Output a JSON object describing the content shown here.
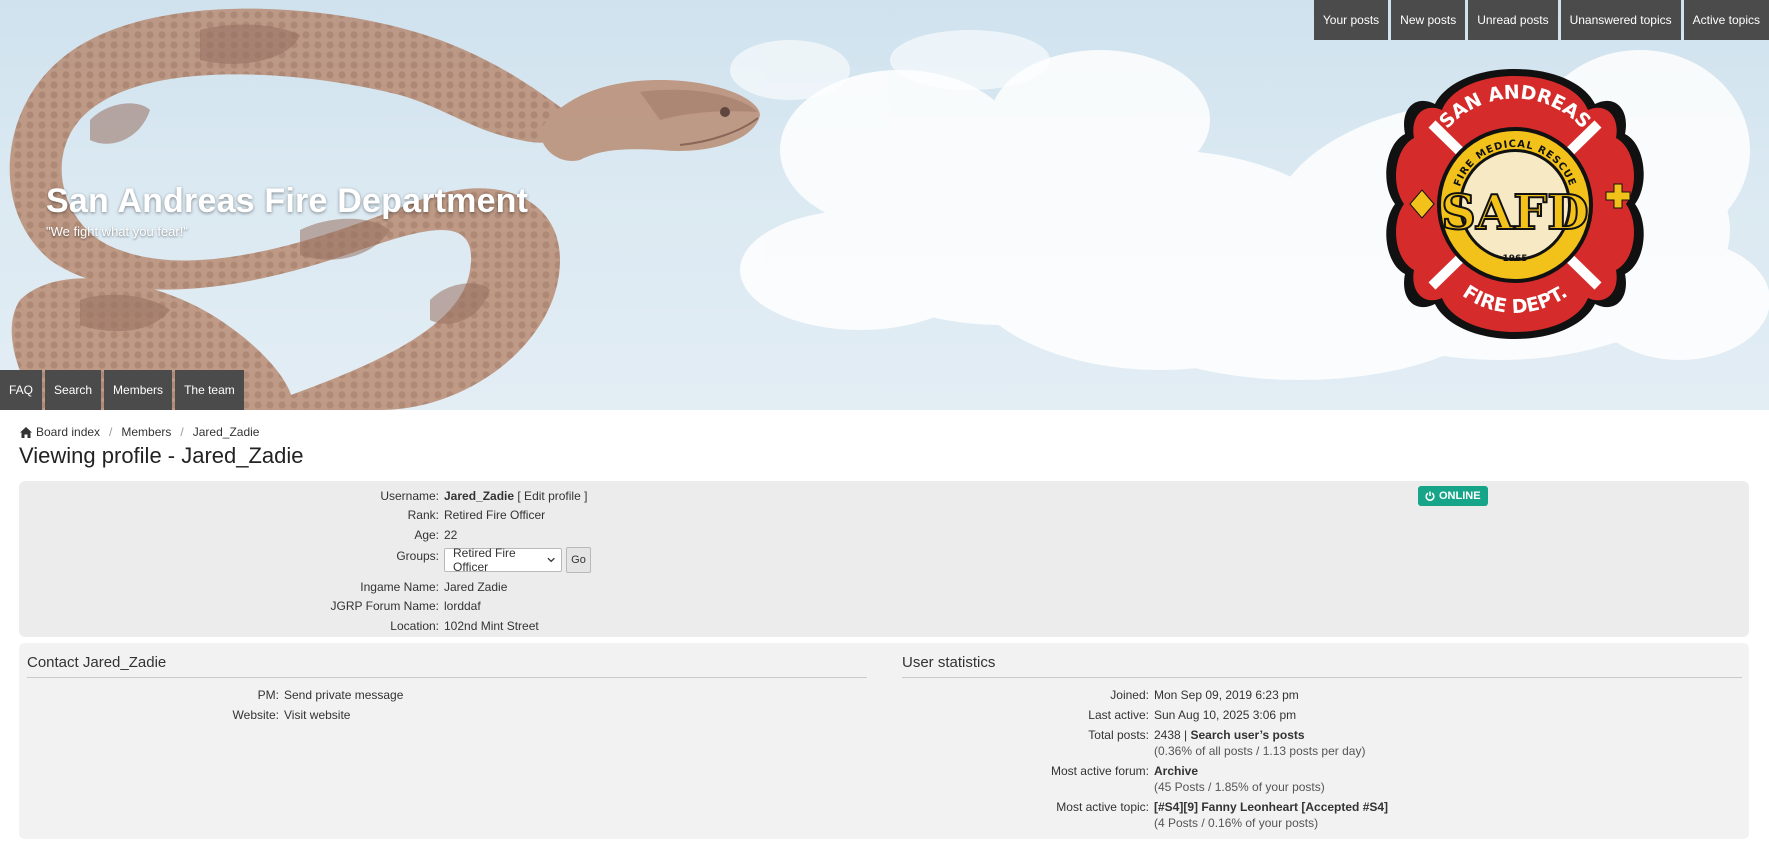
{
  "header": {
    "site_title": "San Andreas Fire Department",
    "site_description": "\"We fight what you fear!\"",
    "logo": {
      "icon": "fire-department-badge-icon",
      "top_text": "SAN ANDREAS",
      "ring_text": "FIRE MEDICAL RESCUE",
      "monogram": "SAFD",
      "year": "1965",
      "bottom_text": "FIRE DEPT."
    }
  },
  "top_nav": [
    "Your posts",
    "New posts",
    "Unread posts",
    "Unanswered topics",
    "Active topics"
  ],
  "bottom_nav": [
    "FAQ",
    "Search",
    "Members",
    "The team"
  ],
  "breadcrumb": [
    "Board index",
    "Members",
    "Jared_Zadie"
  ],
  "page_title": "Viewing profile - Jared_Zadie",
  "profile": {
    "username_label": "Username:",
    "username": "Jared_Zadie",
    "edit_profile": "[ Edit profile ]",
    "rank_label": "Rank:",
    "rank": "Retired Fire Officer",
    "age_label": "Age:",
    "age": "22",
    "groups_label": "Groups:",
    "groups_selected": "Retired Fire Officer",
    "go_label": "Go",
    "ingame_label": "Ingame Name:",
    "ingame": "Jared Zadie",
    "jgrp_label": "JGRP Forum Name:",
    "jgrp": "lorddaf",
    "location_label": "Location:",
    "location": "102nd Mint Street",
    "online_badge": "ONLINE"
  },
  "contact": {
    "title": "Contact Jared_Zadie",
    "pm_label": "PM:",
    "pm_value": "Send private message",
    "website_label": "Website:",
    "website_value": "Visit website"
  },
  "stats": {
    "title": "User statistics",
    "joined_label": "Joined:",
    "joined": "Mon Sep 09, 2019 6:23 pm",
    "last_active_label": "Last active:",
    "last_active": "Sun Aug 10, 2025 3:06 pm",
    "total_posts_label": "Total posts:",
    "total_posts": "2438 |",
    "search_posts": "Search user’s posts",
    "total_posts_sub": "(0.36% of all posts / 1.13 posts per day)",
    "forum_label": "Most active forum:",
    "forum": "Archive",
    "forum_sub": "(45 Posts / 1.85% of your posts)",
    "topic_label": "Most active topic:",
    "topic": "[#S4][9] Fanny Leonheart [Accepted #S4]",
    "topic_sub": "(4 Posts / 0.16% of your posts)"
  },
  "colors": {
    "nav_bg": "#4b4b4b",
    "online": "#17a589",
    "badge_red": "#d62b2b",
    "badge_gold": "#f2c21b"
  }
}
